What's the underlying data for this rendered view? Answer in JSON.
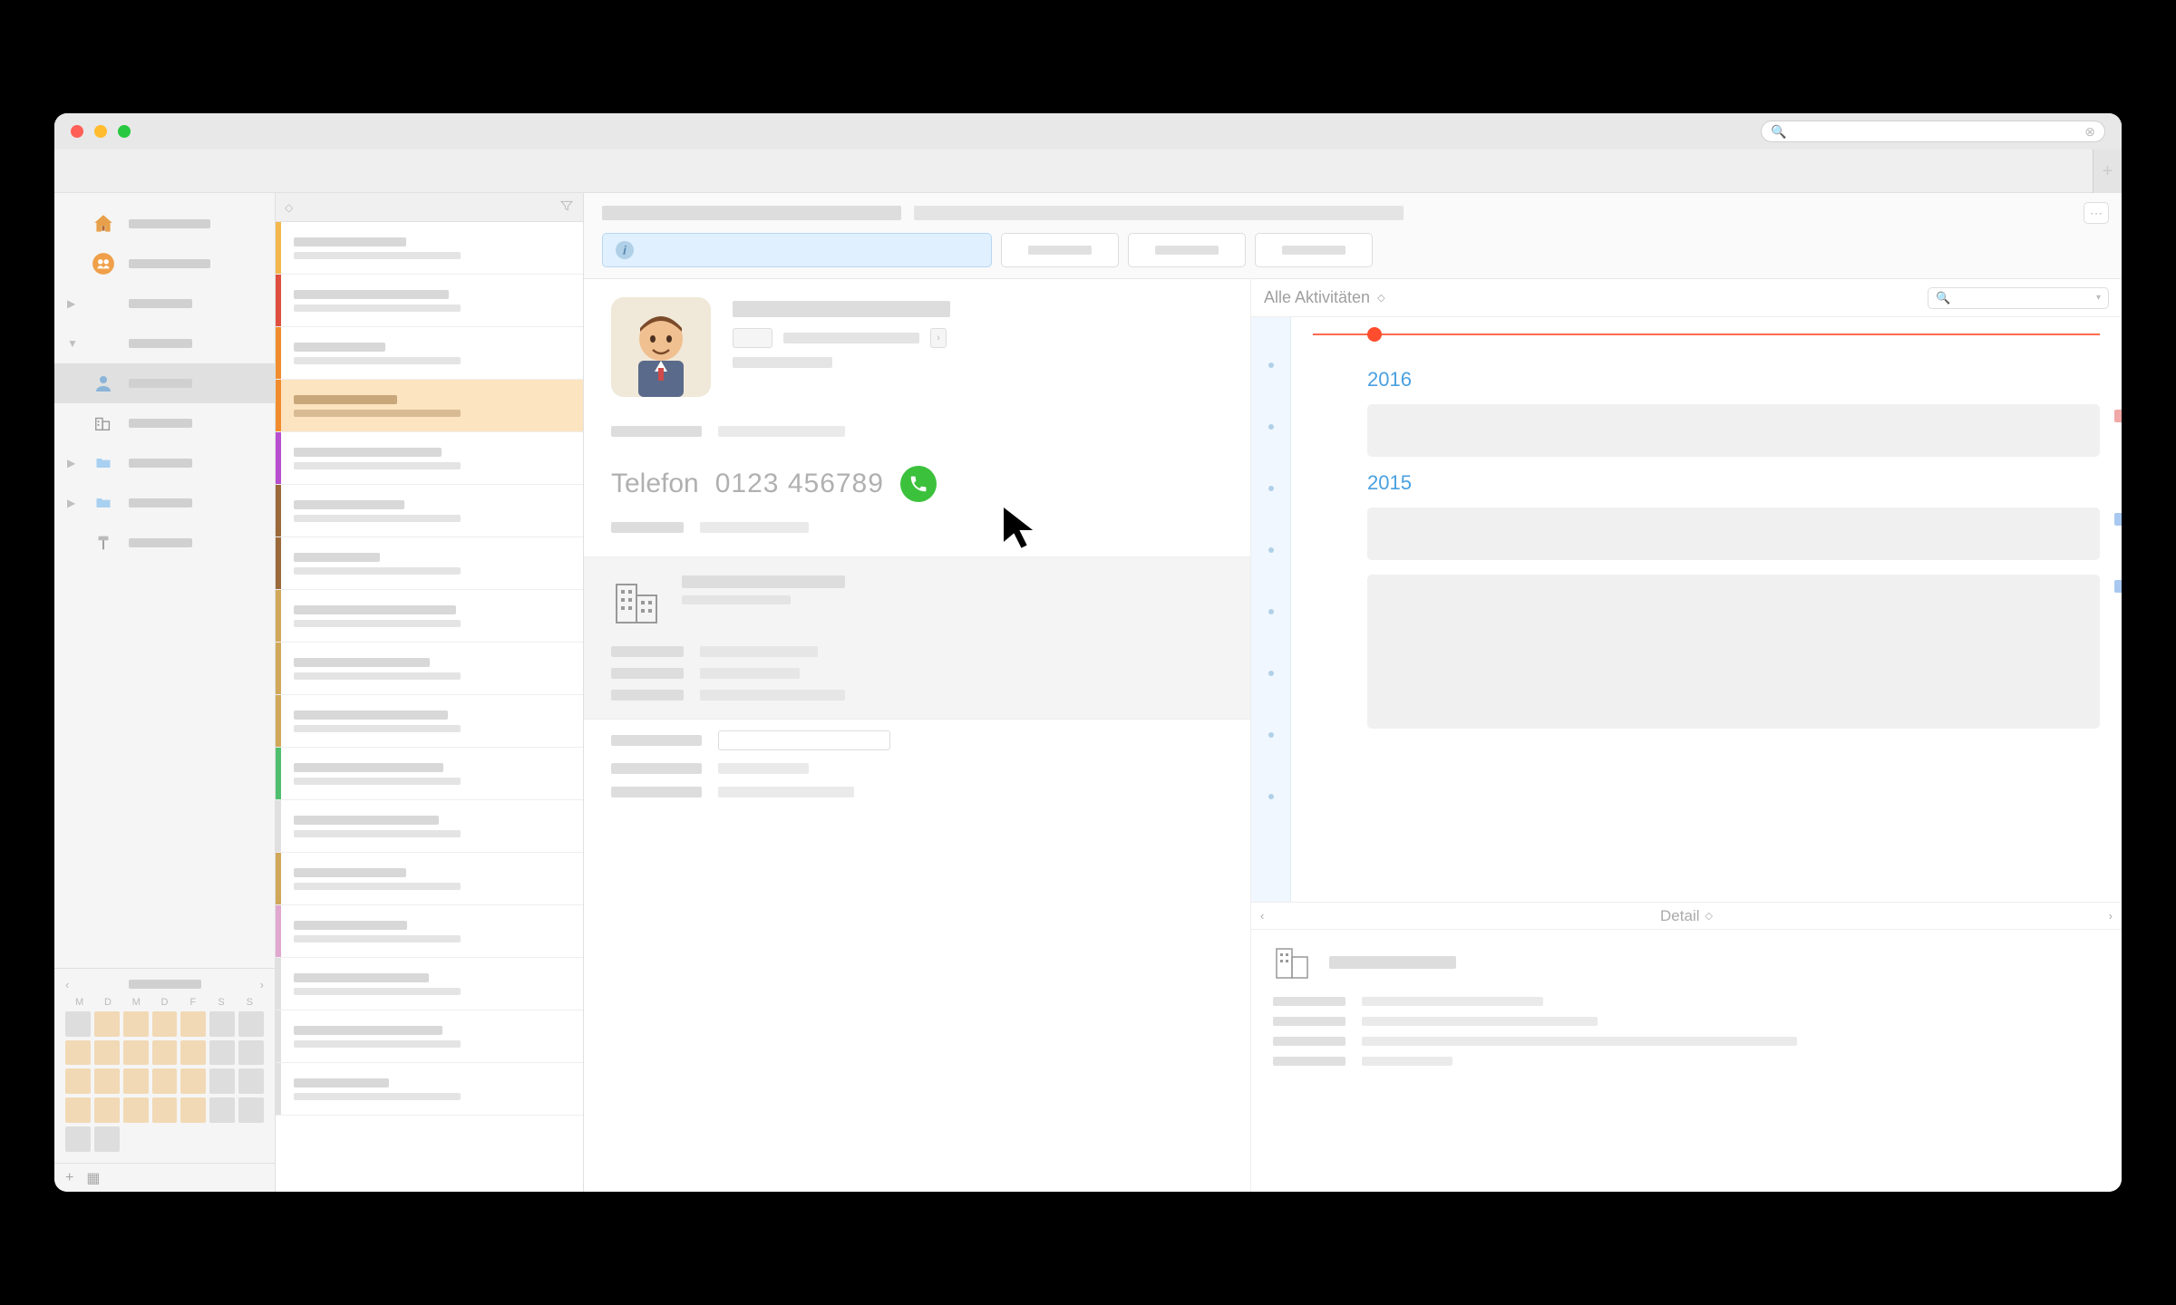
{
  "window": {
    "title": "",
    "search_placeholder": ""
  },
  "sidebar": {
    "items": [
      {
        "icon": "home-icon"
      },
      {
        "icon": "group-icon"
      },
      {
        "icon": "none",
        "disclosure": true
      },
      {
        "icon": "none",
        "disclosure": true,
        "expanded": true
      },
      {
        "icon": "person-icon",
        "selected": true
      },
      {
        "icon": "building-icon"
      },
      {
        "icon": "folder-icon",
        "disclosure": true
      },
      {
        "icon": "folder-icon",
        "disclosure": true
      },
      {
        "icon": "hammer-icon"
      }
    ],
    "calendar": {
      "dow": [
        "M",
        "D",
        "M",
        "D",
        "F",
        "S",
        "S"
      ]
    },
    "footer": {
      "add": "+",
      "grid": "▦"
    }
  },
  "list": {
    "rows": [
      {
        "stripe": "#f2b84d"
      },
      {
        "stripe": "#de4f3f"
      },
      {
        "stripe": "#f08c2e"
      },
      {
        "stripe": "#f08c2e",
        "selected": true
      },
      {
        "stripe": "#b84fcf"
      },
      {
        "stripe": "#9a6a3a"
      },
      {
        "stripe": "#9a6a3a"
      },
      {
        "stripe": "#cfa85a"
      },
      {
        "stripe": "#cfa85a"
      },
      {
        "stripe": "#cfa85a"
      },
      {
        "stripe": "#4fbf6f"
      },
      {
        "stripe": "#e0e0e0"
      },
      {
        "stripe": "#cfa85a"
      },
      {
        "stripe": "#e0a8d0"
      },
      {
        "stripe": "#e0e0e0"
      },
      {
        "stripe": "#e0e0e0"
      },
      {
        "stripe": "#e0e0e0"
      }
    ]
  },
  "contact": {
    "phone_label": "Telefon",
    "phone_number": "0123 456789"
  },
  "activity": {
    "dropdown_label": "Alle Aktivitäten",
    "years": [
      "2016",
      "2015"
    ],
    "detail_label": "Detail"
  },
  "colors": {
    "call_green": "#3cc13c",
    "info_blue": "#e0f0ff",
    "accent_blue": "#4aa0e0"
  }
}
